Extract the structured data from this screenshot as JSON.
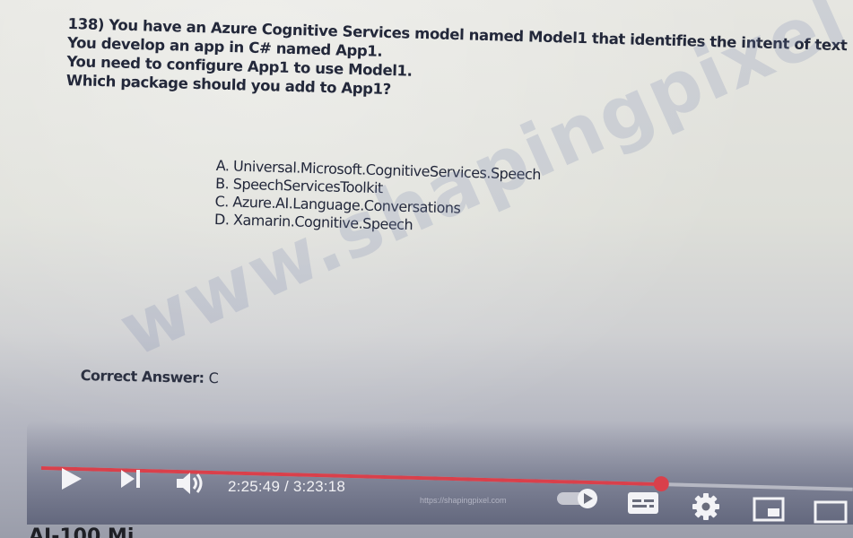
{
  "question": {
    "lines": [
      "138) You have an Azure Cognitive Services model named Model1 that identifies the intent of text input.",
      "You develop an app in C# named App1.",
      "You need to configure App1 to use Model1.",
      "Which package should you add to App1?"
    ]
  },
  "options": [
    "A. Universal.Microsoft.CognitiveServices.Speech",
    "B. SpeechServicesToolkit",
    "C. Azure.AI.Language.Conversations",
    "D. Xamarin.Cognitive.Speech"
  ],
  "answer": {
    "label": "Correct Answer:",
    "value": "C"
  },
  "watermark": "www.shapingpixel.com",
  "player": {
    "progress_fraction": 0.7635,
    "time_display": "2:25:49 / 3:23:18",
    "url_overlay": "https://shapingpixel.com",
    "accent_color": "#d9404b",
    "icons": [
      "play-icon",
      "next-icon",
      "volume-icon",
      "autoplay-toggle-icon",
      "subtitles-icon",
      "gear-icon",
      "miniplayer-icon",
      "fullscreen-icon"
    ]
  },
  "below_title": "AI-100 Mi"
}
